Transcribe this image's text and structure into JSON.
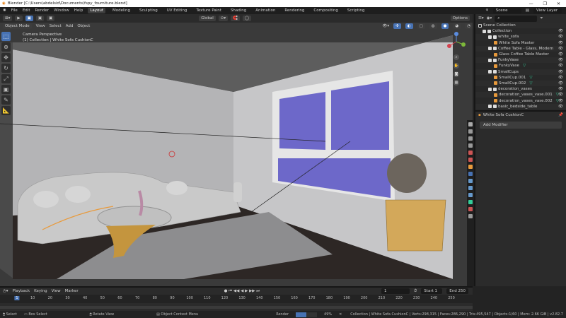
{
  "window": {
    "title": "Blender [C:\\Users\\abdelsid\\Documents\\fspy_fourniture.blend]",
    "min": "—",
    "max": "❐",
    "close": "✕"
  },
  "menu": [
    "File",
    "Edit",
    "Render",
    "Window",
    "Help"
  ],
  "workspaces": [
    "Layout",
    "Modeling",
    "Sculpting",
    "UV Editing",
    "Texture Paint",
    "Shading",
    "Animation",
    "Rendering",
    "Compositing",
    "Scripting"
  ],
  "scene": {
    "scene_name": "Scene",
    "view_layer": "View Layer"
  },
  "toolheader": {
    "orientation": "Global",
    "options": "Options"
  },
  "viewport": {
    "mode": "Object Mode",
    "menus": [
      "View",
      "Select",
      "Add",
      "Object"
    ],
    "info_line1": "Camera Perspective",
    "info_line2": "(1) Collection | White Sofa CushionC"
  },
  "outliner": {
    "root": "Scene Collection",
    "items": [
      {
        "label": "Collection",
        "depth": 0,
        "type": "collection"
      },
      {
        "label": "white_sofa",
        "depth": 1,
        "type": "collection"
      },
      {
        "label": "White Sofa Master",
        "depth": 2,
        "type": "object"
      },
      {
        "label": "Coffee Table - Glass, Modern",
        "depth": 1,
        "type": "collection"
      },
      {
        "label": "Glass Coffee Table Master",
        "depth": 2,
        "type": "object"
      },
      {
        "label": "FunkyVase",
        "depth": 1,
        "type": "collection"
      },
      {
        "label": "FunkyVase",
        "depth": 2,
        "type": "mesh"
      },
      {
        "label": "SmallCups",
        "depth": 1,
        "type": "collection"
      },
      {
        "label": "SmallCup.001",
        "depth": 2,
        "type": "mesh"
      },
      {
        "label": "SmallCup.002",
        "depth": 2,
        "type": "mesh"
      },
      {
        "label": "decoration_vases",
        "depth": 1,
        "type": "collection"
      },
      {
        "label": "decoration_vases_vase.001",
        "depth": 2,
        "type": "mesh"
      },
      {
        "label": "decoration_vases_vase.002",
        "depth": 2,
        "type": "mesh"
      },
      {
        "label": "basic_bedside_table",
        "depth": 1,
        "type": "collection"
      }
    ]
  },
  "properties": {
    "object_name": "White Sofa CushionC",
    "add_modifier": "Add Modifier"
  },
  "timeline": {
    "menus": [
      "Playback",
      "Keying",
      "View",
      "Marker"
    ],
    "current_frame": "1",
    "start_label": "Start",
    "start": "1",
    "end_label": "End",
    "end": "250",
    "ticks": [
      1,
      10,
      20,
      30,
      40,
      50,
      60,
      70,
      80,
      90,
      100,
      110,
      120,
      130,
      140,
      150,
      160,
      170,
      180,
      190,
      200,
      210,
      220,
      230,
      240,
      250
    ]
  },
  "status": {
    "select": "Select",
    "box_select": "Box Select",
    "rotate": "Rotate View",
    "context": "Object Context Menu",
    "render": "Render",
    "progress": "49%",
    "progress_value": 49,
    "stats": "Collection | White Sofa CushionC | Verts:298,315 | Faces:286,290 | Tris:495,547 | Objects:1/60 | Mem: 2.66 GiB | v2.82.7"
  },
  "colors": {
    "accent": "#4772b3",
    "window_glass": "#6d68c9",
    "selected": "#e89a3c"
  }
}
